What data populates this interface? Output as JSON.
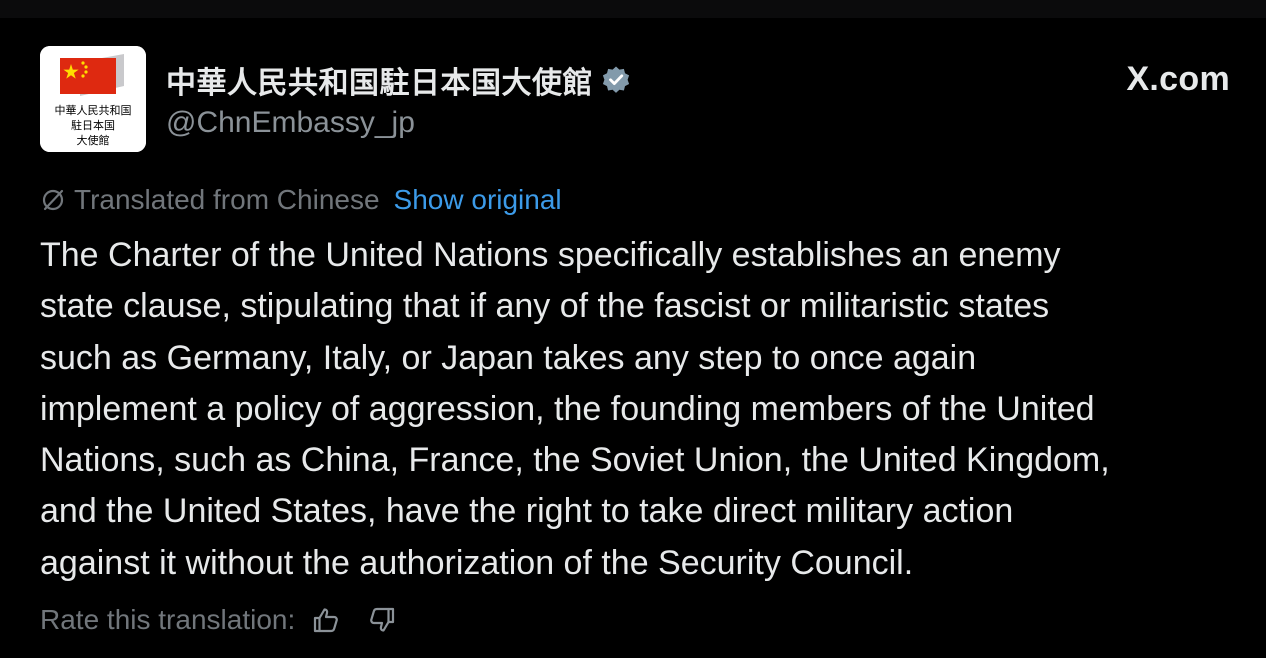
{
  "account": {
    "display_name": "中華人民共和国駐日本国大使館",
    "handle": "@ChnEmbassy_jp",
    "verified_icon": "verified-badge-icon",
    "avatar_lines": [
      "中華人民共和国",
      "駐日本国",
      "大使館"
    ]
  },
  "site_label": "X.com",
  "translation": {
    "notice": "Translated from Chinese",
    "show_original": "Show original"
  },
  "body_lines": [
    "The Charter of the United Nations specifically establishes an enemy",
    "state clause, stipulating that if any of the fascist or militaristic states",
    "such as Germany, Italy, or Japan takes any step to once again",
    "implement a policy of aggression, the founding members of the United",
    "Nations, such as China, France, the Soviet Union, the United Kingdom,",
    "and the United States, have the right to take direct military action",
    "against it without the authorization of the Security Council."
  ],
  "rating": {
    "label": "Rate this translation:"
  },
  "colors": {
    "background": "#000000",
    "text_primary": "#e7e9ea",
    "text_secondary": "#71767b",
    "link": "#3c9be9",
    "flag_red": "#de2910",
    "flag_yellow": "#ffde00"
  }
}
